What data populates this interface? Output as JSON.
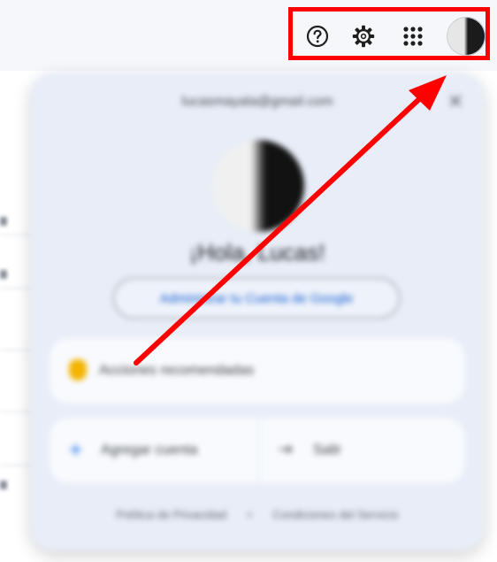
{
  "header": {
    "icons": [
      "help-icon",
      "settings-icon",
      "apps-grid-icon",
      "account-avatar"
    ]
  },
  "panel": {
    "email": "lucasmayala@gmail.com",
    "greeting": "¡Hola, Lucas!",
    "manage_label": "Administrar tu Cuenta de Google",
    "actions_label": "Acciones recomendadas",
    "add_account_label": "Agregar cuenta",
    "signout_label": "Salir",
    "privacy_label": "Política de Privacidad",
    "separator": "•",
    "terms_label": "Condiciones del Servicio",
    "close_glyph": "✕"
  },
  "colors": {
    "annotation": "#ff0000",
    "accent": "#0b57d0"
  }
}
